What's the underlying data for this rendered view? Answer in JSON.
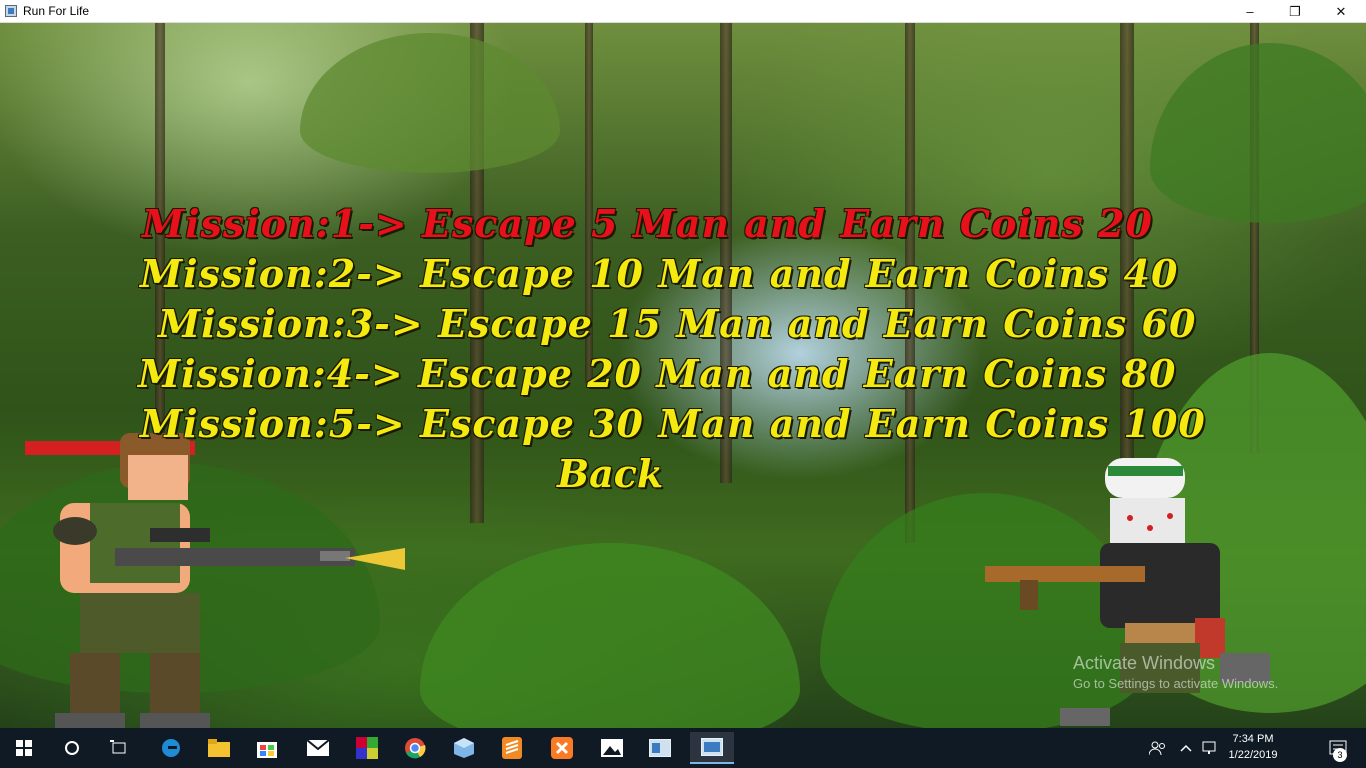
{
  "window": {
    "title": "Run For Life",
    "controls": {
      "minimize": "–",
      "maximize": "❐",
      "close": "✕"
    }
  },
  "menu": {
    "missions": [
      "Mission:1-> Escape 5 Man and Earn Coins 20",
      "Mission:2-> Escape 10 Man and Earn Coins 40",
      "Mission:3-> Escape 15 Man and Earn Coins 60",
      "Mission:4-> Escape 20 Man and Earn Coins 80",
      "Mission:5-> Escape 30 Man and Earn Coins 100"
    ],
    "back": "Back",
    "colors": {
      "selected": "#e8101a",
      "normal": "#f4ea10"
    }
  },
  "watermark": {
    "title": "Activate Windows",
    "subtitle": "Go to Settings to activate Windows."
  },
  "taskbar": {
    "apps": [
      "start-icon",
      "cortana-icon",
      "task-view-icon",
      "edge-icon",
      "file-explorer-icon",
      "store-icon",
      "mail-icon",
      "winrar-icon",
      "chrome-icon",
      "virtualbox-icon",
      "sublime-icon",
      "xampp-icon",
      "photos-icon",
      "app-icon",
      "run-for-life-icon"
    ],
    "time": "7:34 PM",
    "date": "1/22/2019",
    "notifications": "3"
  }
}
